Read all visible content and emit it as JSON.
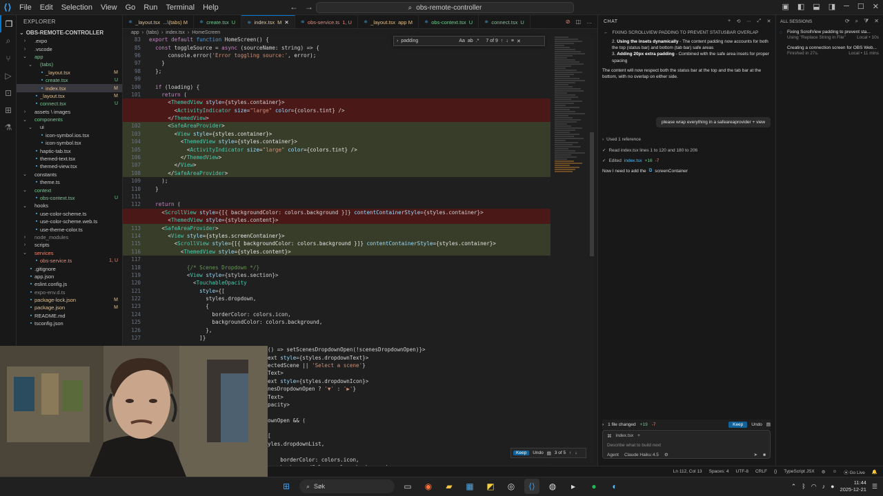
{
  "titlebar": {
    "menus": [
      "File",
      "Edit",
      "Selection",
      "View",
      "Go",
      "Run",
      "Terminal",
      "Help"
    ],
    "search_text": "obs-remote-controller"
  },
  "explorer": {
    "header": "EXPLORER",
    "project": "OBS-REMOTE-CONTROLLER",
    "tree": [
      {
        "label": ".expo",
        "indent": 1,
        "type": "folder",
        "open": false,
        "color": "#cccccc",
        "badge": ""
      },
      {
        "label": ".vscode",
        "indent": 1,
        "type": "folder",
        "open": false,
        "color": "#cccccc",
        "badge": ""
      },
      {
        "label": "app",
        "indent": 1,
        "type": "folder",
        "open": true,
        "color": "#73c991",
        "badge": ""
      },
      {
        "label": "(tabs)",
        "indent": 2,
        "type": "folder",
        "open": true,
        "color": "#73c991",
        "badge": ""
      },
      {
        "label": "_layout.tsx",
        "indent": 3,
        "type": "file",
        "color": "#e2c08d",
        "badge": "M"
      },
      {
        "label": "create.tsx",
        "indent": 3,
        "type": "file",
        "color": "#73c991",
        "badge": "U"
      },
      {
        "label": "index.tsx",
        "indent": 3,
        "type": "file",
        "color": "#e2c08d",
        "badge": "M",
        "selected": true
      },
      {
        "label": "_layout.tsx",
        "indent": 2,
        "type": "file",
        "color": "#e2c08d",
        "badge": "M"
      },
      {
        "label": "connect.tsx",
        "indent": 2,
        "type": "file",
        "color": "#73c991",
        "badge": "U"
      },
      {
        "label": "assets \\ images",
        "indent": 1,
        "type": "folder",
        "open": false,
        "color": "#cccccc",
        "badge": ""
      },
      {
        "label": "components",
        "indent": 1,
        "type": "folder",
        "open": true,
        "color": "#73c991",
        "badge": ""
      },
      {
        "label": "ui",
        "indent": 2,
        "type": "folder",
        "open": true,
        "color": "#cccccc",
        "badge": ""
      },
      {
        "label": "icon-symbol.ios.tsx",
        "indent": 3,
        "type": "file",
        "color": "#cccccc",
        "badge": ""
      },
      {
        "label": "icon-symbol.tsx",
        "indent": 3,
        "type": "file",
        "color": "#cccccc",
        "badge": ""
      },
      {
        "label": "haptic-tab.tsx",
        "indent": 2,
        "type": "file",
        "color": "#cccccc",
        "badge": ""
      },
      {
        "label": "themed-text.tsx",
        "indent": 2,
        "type": "file",
        "color": "#cccccc",
        "badge": ""
      },
      {
        "label": "themed-view.tsx",
        "indent": 2,
        "type": "file",
        "color": "#cccccc",
        "badge": ""
      },
      {
        "label": "constants",
        "indent": 1,
        "type": "folder",
        "open": true,
        "color": "#cccccc",
        "badge": ""
      },
      {
        "label": "theme.ts",
        "indent": 2,
        "type": "file",
        "color": "#cccccc",
        "badge": ""
      },
      {
        "label": "context",
        "indent": 1,
        "type": "folder",
        "open": true,
        "color": "#73c991",
        "badge": ""
      },
      {
        "label": "obs-context.tsx",
        "indent": 2,
        "type": "file",
        "color": "#73c991",
        "badge": "U"
      },
      {
        "label": "hooks",
        "indent": 1,
        "type": "folder",
        "open": true,
        "color": "#cccccc",
        "badge": ""
      },
      {
        "label": "use-color-scheme.ts",
        "indent": 2,
        "type": "file",
        "color": "#cccccc",
        "badge": ""
      },
      {
        "label": "use-color-scheme.web.ts",
        "indent": 2,
        "type": "file",
        "color": "#cccccc",
        "badge": ""
      },
      {
        "label": "use-theme-color.ts",
        "indent": 2,
        "type": "file",
        "color": "#cccccc",
        "badge": ""
      },
      {
        "label": "node_modules",
        "indent": 1,
        "type": "folder",
        "open": false,
        "color": "#8c8c8c",
        "badge": ""
      },
      {
        "label": "scripts",
        "indent": 1,
        "type": "folder",
        "open": false,
        "color": "#cccccc",
        "badge": ""
      },
      {
        "label": "services",
        "indent": 1,
        "type": "folder",
        "open": true,
        "color": "#f48771",
        "badge": ""
      },
      {
        "label": "obs-service.ts",
        "indent": 2,
        "type": "file",
        "color": "#f48771",
        "badge": "1, U"
      },
      {
        "label": ".gitignore",
        "indent": 1,
        "type": "file",
        "color": "#cccccc",
        "badge": ""
      },
      {
        "label": "app.json",
        "indent": 1,
        "type": "file",
        "color": "#cccccc",
        "badge": ""
      },
      {
        "label": "eslint.config.js",
        "indent": 1,
        "type": "file",
        "color": "#cccccc",
        "badge": ""
      },
      {
        "label": "expo-env.d.ts",
        "indent": 1,
        "type": "file",
        "color": "#8c8c8c",
        "badge": ""
      },
      {
        "label": "package-lock.json",
        "indent": 1,
        "type": "file",
        "color": "#e2c08d",
        "badge": "M"
      },
      {
        "label": "package.json",
        "indent": 1,
        "type": "file",
        "color": "#e2c08d",
        "badge": "M"
      },
      {
        "label": "README.md",
        "indent": 1,
        "type": "file",
        "color": "#cccccc",
        "badge": ""
      },
      {
        "label": "tsconfig.json",
        "indent": 1,
        "type": "file",
        "color": "#cccccc",
        "badge": ""
      }
    ]
  },
  "tabs": [
    {
      "label": "_layout.tsx",
      "suffix": "...\\(tabs)  M",
      "active": false,
      "state": "mod"
    },
    {
      "label": "create.tsx",
      "suffix": "U",
      "active": false,
      "state": "add"
    },
    {
      "label": "index.tsx",
      "suffix": "M",
      "active": true,
      "state": "mod"
    },
    {
      "label": "obs-service.ts",
      "suffix": "1, U",
      "active": false,
      "state": "err"
    },
    {
      "label": "_layout.tsx",
      "suffix": "app  M",
      "active": false,
      "state": "mod"
    },
    {
      "label": "obs-context.tsx",
      "suffix": "U",
      "active": false,
      "state": "add"
    },
    {
      "label": "connect.tsx",
      "suffix": "U",
      "active": false,
      "state": "add"
    }
  ],
  "breadcrumb": [
    "app",
    "(tabs)",
    "index.tsx",
    "HomeScreen"
  ],
  "find": {
    "value": "padding",
    "count": "7 of 9"
  },
  "code_lines": [
    {
      "n": "83",
      "t": "export default function HomeScreen() {",
      "k": ""
    },
    {
      "n": "85",
      "t": "  const toggleSource = async (sourceName: string) => {",
      "k": ""
    },
    {
      "n": "96",
      "t": "      console.error('Error toggling source:', error);",
      "k": ""
    },
    {
      "n": "97",
      "t": "    }",
      "k": ""
    },
    {
      "n": "98",
      "t": "  };",
      "k": ""
    },
    {
      "n": "99",
      "t": "",
      "k": ""
    },
    {
      "n": "100",
      "t": "  if (loading) {",
      "k": ""
    },
    {
      "n": "101",
      "t": "    return (",
      "k": ""
    },
    {
      "n": "",
      "t": "      <ThemedView style={styles.container}>",
      "k": "del"
    },
    {
      "n": "",
      "t": "        <ActivityIndicator size=\"large\" color={colors.tint} />",
      "k": "del"
    },
    {
      "n": "",
      "t": "      </ThemedView>",
      "k": "del"
    },
    {
      "n": "102",
      "t": "      <SafeAreaProvider>",
      "k": "add"
    },
    {
      "n": "103",
      "t": "        <View style={styles.container}>",
      "k": "add"
    },
    {
      "n": "104",
      "t": "          <ThemedView style={styles.container}>",
      "k": "add"
    },
    {
      "n": "105",
      "t": "            <ActivityIndicator size=\"large\" color={colors.tint} />",
      "k": "add"
    },
    {
      "n": "106",
      "t": "          </ThemedView>",
      "k": "add"
    },
    {
      "n": "107",
      "t": "        </View>",
      "k": "add"
    },
    {
      "n": "108",
      "t": "      </SafeAreaProvider>",
      "k": "add"
    },
    {
      "n": "109",
      "t": "    );",
      "k": ""
    },
    {
      "n": "110",
      "t": "  }",
      "k": ""
    },
    {
      "n": "111",
      "t": "",
      "k": ""
    },
    {
      "n": "112",
      "t": "  return (",
      "k": ""
    },
    {
      "n": "",
      "t": "    <ScrollView style={[{ backgroundColor: colors.background }]} contentContainerStyle={styles.container}>",
      "k": "del"
    },
    {
      "n": "",
      "t": "      <ThemedView style={styles.content}>",
      "k": "del"
    },
    {
      "n": "113",
      "t": "    <SafeAreaProvider>",
      "k": "add"
    },
    {
      "n": "114",
      "t": "      <View style={styles.screenContainer}>",
      "k": "add"
    },
    {
      "n": "115",
      "t": "        <ScrollView style={[{ backgroundColor: colors.background }]} contentContainerStyle={styles.container}>",
      "k": "add"
    },
    {
      "n": "116",
      "t": "          <ThemedView style={styles.content}>",
      "k": "add"
    },
    {
      "n": "117",
      "t": "",
      "k": ""
    },
    {
      "n": "118",
      "t": "            {/* Scenes Dropdown */}",
      "k": ""
    },
    {
      "n": "119",
      "t": "            <View style={styles.section}>",
      "k": ""
    },
    {
      "n": "120",
      "t": "              <TouchableOpacity",
      "k": ""
    },
    {
      "n": "121",
      "t": "                style={[",
      "k": ""
    },
    {
      "n": "122",
      "t": "                  styles.dropdown,",
      "k": ""
    },
    {
      "n": "123",
      "t": "                  {",
      "k": ""
    },
    {
      "n": "124",
      "t": "                    borderColor: colors.icon,",
      "k": ""
    },
    {
      "n": "125",
      "t": "                    backgroundColor: colors.background,",
      "k": ""
    },
    {
      "n": "126",
      "t": "                  },",
      "k": ""
    },
    {
      "n": "127",
      "t": "                ]}",
      "k": ""
    }
  ],
  "code_lines_lower": [
    "() => setScenesDropdownOpen(!scenesDropdownOpen)}>",
    "ext style={styles.dropdownText}>",
    "ectedScene || 'Select a scene'}",
    "Text>",
    "ext style={styles.dropdownIcon}>",
    "nesDropdownOpen ? '▼' : '▶'}",
    "Text>",
    "pacity>",
    "",
    "ownOpen && (",
    "",
    "[",
    "yles.dropdownList,",
    "",
    "    borderColor: colors.icon,",
    "    backgroundColor: colors.background,"
  ],
  "inline_diff": {
    "keep": "Keep",
    "undo": "Undo",
    "count": "3 of 5"
  },
  "chat": {
    "header": "CHAT",
    "title": "FIXING SCROLLVIEW PADDING TO PREVENT STATUSBAR OVERLAP",
    "points": [
      {
        "n": "2.",
        "bold": "Using the insets dynamically",
        "rest": " - The content padding now accounts for both the top (status bar) and bottom (tab bar) safe areas"
      },
      {
        "n": "3.",
        "bold": "Adding 20px extra padding",
        "rest": " - Combined with the safe area insets for proper spacing"
      }
    ],
    "summary": "The content will now respect both the status bar at the top and the tab bar at the bottom, with no overlap on either side.",
    "user_message": "please wrap everything in a safeareaprovider + view",
    "used_ref": "Used 1 reference",
    "read_line": "Read index.tsx lines 1 to 120 and 180 to 206",
    "edited_label": "Edited",
    "edited_file": "index.tsx",
    "edited_plus": "+16",
    "edited_minus": "-7",
    "now_text": "Now I need to add the",
    "now_chip": "screenContainer",
    "changed_label": "1 file changed",
    "changed_plus": "+19",
    "changed_minus": "-7",
    "keep": "Keep",
    "undo": "Undo",
    "ctx_file": "index.tsx",
    "placeholder": "Describe what to build next",
    "agent": "Agent",
    "model": "Claude Haiku 4.5"
  },
  "sessions": {
    "header": "ALL SESSIONS",
    "items": [
      {
        "title": "Fixing ScrollView padding to prevent sta...",
        "sub": "Using \"Replace String in File\"",
        "meta": "Local • 10s"
      },
      {
        "title": "Creating a connection screen for OBS Web...",
        "sub": "Finished in 27s.",
        "meta": "Local • 11 mins"
      }
    ]
  },
  "statusbar": {
    "position": "Ln 112, Col 13",
    "spaces": "Spaces: 4",
    "encoding": "UTF-8",
    "eol": "CRLF",
    "language": "TypeScript JSX",
    "golive": "Go Live"
  },
  "taskbar": {
    "search": "Søk",
    "time": "11:44",
    "date": "2025-12-21"
  }
}
